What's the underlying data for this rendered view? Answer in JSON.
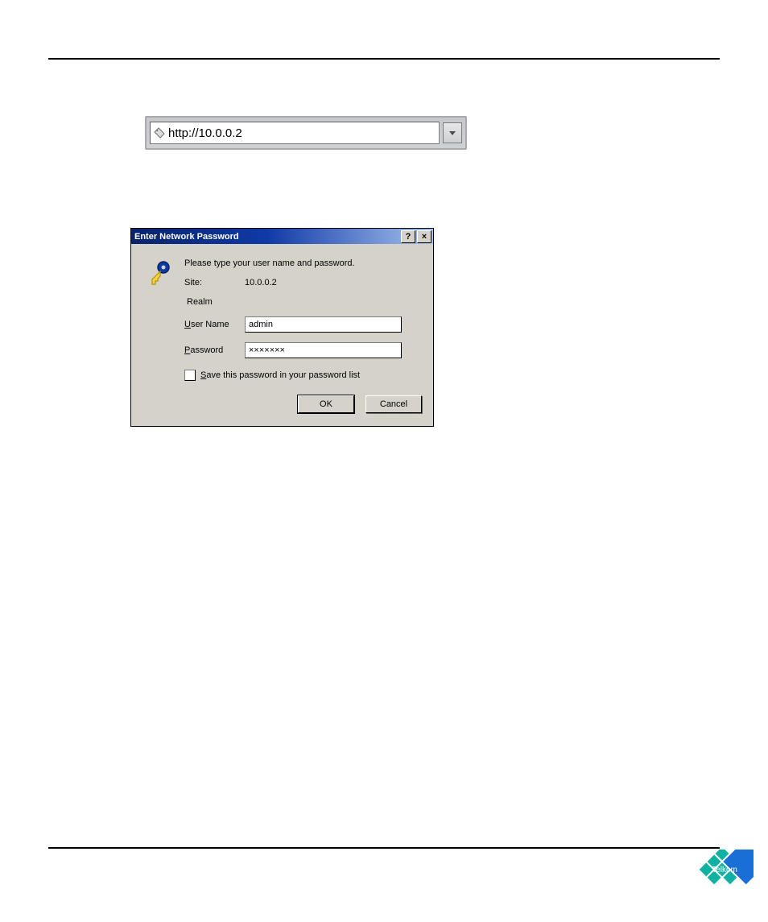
{
  "addressbar": {
    "url": "http://10.0.0.2"
  },
  "dialog": {
    "title": "Enter Network Password",
    "help_btn": "?",
    "close_btn": "×",
    "instruction": "Please type your user name and password.",
    "site_label": "Site:",
    "site_value": "10.0.0.2",
    "realm_label": "Realm",
    "username_label_pre": "U",
    "username_label_post": "ser Name",
    "username_value": "admin",
    "password_label_pre": "P",
    "password_label_post": "assword",
    "password_value": "×××××××",
    "save_label_pre": "S",
    "save_label_post": "ave this password in your password list",
    "ok_label": "OK",
    "cancel_label": "Cancel"
  },
  "brand": {
    "name": "Telkom"
  }
}
